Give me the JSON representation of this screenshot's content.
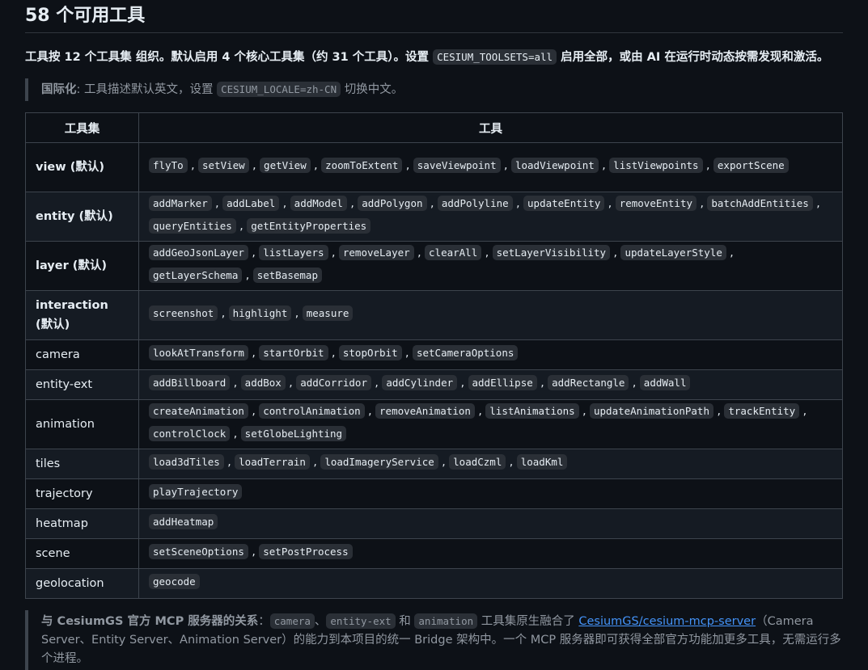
{
  "heading": "58 个可用工具",
  "intro": {
    "text_before": "工具按 12 个工具集 组织。默认启用 4 个核心工具集（约 31 个工具）。设置 ",
    "code": "CESIUM_TOOLSETS=all",
    "text_after": " 启用全部，或由 AI 在运行时动态按需发现和激活。"
  },
  "i18n_note": {
    "label": "国际化",
    "text_before": ": 工具描述默认英文，设置 ",
    "code": "CESIUM_LOCALE=zh-CN",
    "text_after": " 切换中文。"
  },
  "table": {
    "headers": [
      "工具集",
      "工具"
    ],
    "rows": [
      {
        "name": "view",
        "suffix": " (默认)",
        "bold": true,
        "tools": [
          "flyTo",
          "setView",
          "getView",
          "zoomToExtent",
          "saveViewpoint",
          "loadViewpoint",
          "listViewpoints",
          "exportScene"
        ]
      },
      {
        "name": "entity",
        "suffix": " (默认)",
        "bold": true,
        "tools": [
          "addMarker",
          "addLabel",
          "addModel",
          "addPolygon",
          "addPolyline",
          "updateEntity",
          "removeEntity",
          "batchAddEntities",
          "queryEntities",
          "getEntityProperties"
        ]
      },
      {
        "name": "layer",
        "suffix": " (默认)",
        "bold": true,
        "tools": [
          "addGeoJsonLayer",
          "listLayers",
          "removeLayer",
          "clearAll",
          "setLayerVisibility",
          "updateLayerStyle",
          "getLayerSchema",
          "setBasemap"
        ]
      },
      {
        "name": "interaction",
        "suffix": " (默认)",
        "bold": true,
        "tools": [
          "screenshot",
          "highlight",
          "measure"
        ]
      },
      {
        "name": "camera",
        "suffix": "",
        "bold": false,
        "tools": [
          "lookAtTransform",
          "startOrbit",
          "stopOrbit",
          "setCameraOptions"
        ]
      },
      {
        "name": "entity-ext",
        "suffix": "",
        "bold": false,
        "tools": [
          "addBillboard",
          "addBox",
          "addCorridor",
          "addCylinder",
          "addEllipse",
          "addRectangle",
          "addWall"
        ]
      },
      {
        "name": "animation",
        "suffix": "",
        "bold": false,
        "tools": [
          "createAnimation",
          "controlAnimation",
          "removeAnimation",
          "listAnimations",
          "updateAnimationPath",
          "trackEntity",
          "controlClock",
          "setGlobeLighting"
        ]
      },
      {
        "name": "tiles",
        "suffix": "",
        "bold": false,
        "tools": [
          "load3dTiles",
          "loadTerrain",
          "loadImageryService",
          "loadCzml",
          "loadKml"
        ]
      },
      {
        "name": "trajectory",
        "suffix": "",
        "bold": false,
        "tools": [
          "playTrajectory"
        ]
      },
      {
        "name": "heatmap",
        "suffix": "",
        "bold": false,
        "tools": [
          "addHeatmap"
        ]
      },
      {
        "name": "scene",
        "suffix": "",
        "bold": false,
        "tools": [
          "setSceneOptions",
          "setPostProcess"
        ]
      },
      {
        "name": "geolocation",
        "suffix": "",
        "bold": false,
        "tools": [
          "geocode"
        ]
      }
    ]
  },
  "relation_note": {
    "label": "与 CesiumGS 官方 MCP 服务器的关系",
    "colon": "：",
    "codes": [
      "camera",
      "entity-ext",
      "animation"
    ],
    "sep1": "、",
    "sep2": " 和 ",
    "text_mid": " 工具集原生融合了 ",
    "link_text": "CesiumGS/cesium-mcp-server",
    "text_after": "（Camera Server、Entity Server、Animation Server）的能力到本项目的统一 Bridge 架构中。一个 MCP 服务器即可获得全部官方功能加更多工具，无需运行多个进程。"
  }
}
